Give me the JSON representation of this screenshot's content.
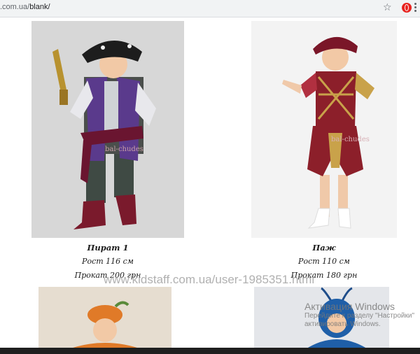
{
  "browser": {
    "url_prefix": ".com.ua/",
    "url_path": "blank/",
    "icons": [
      "star-icon",
      "opera-icon",
      "menu-icon"
    ]
  },
  "products": [
    {
      "title": "Пират 1",
      "height": "Рост 116 см",
      "price": "Прокат 200 грн",
      "photo_label": "bal-chudes"
    },
    {
      "title": "Паж",
      "height": "Рост 110 см",
      "price": "Прокат 180 грн",
      "photo_label": "bal-chudes"
    }
  ],
  "watermark": "www.kidstaff.com.ua/user-1985351.html",
  "windows_activation": {
    "title": "Активация Windows",
    "line1": "Перейдите к разделу \"Настройки\"",
    "line2": "активировать Windows."
  },
  "colors": {
    "pirate_vest": "#5a3a8c",
    "page_vest": "#8c1f2a",
    "gold": "#c9a24a"
  }
}
